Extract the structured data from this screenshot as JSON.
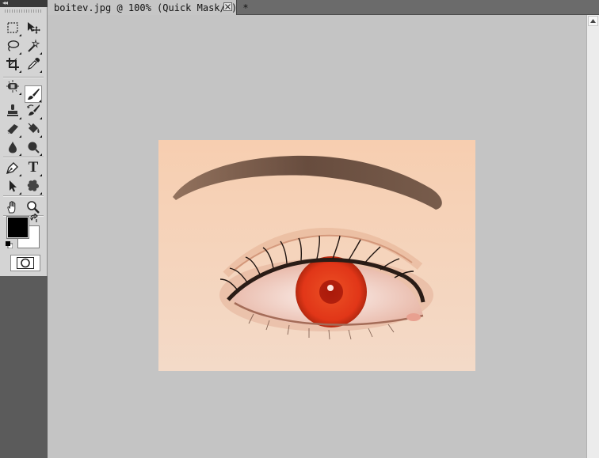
{
  "document": {
    "tab_title": "boitev.jpg @ 100% (Quick Mask/8) *"
  },
  "toolbox": {
    "collapse_glyph": "◂◂",
    "foreground_color": "#000000",
    "background_color": "#ffffff",
    "tools": [
      {
        "name": "rectangular-marquee-tool",
        "icon": "marquee-icon"
      },
      {
        "name": "move-tool",
        "icon": "move-icon"
      },
      {
        "name": "lasso-tool",
        "icon": "lasso-icon"
      },
      {
        "name": "magic-wand-tool",
        "icon": "magic-wand-icon"
      },
      {
        "name": "crop-tool",
        "icon": "crop-icon"
      },
      {
        "name": "eyedropper-tool",
        "icon": "eyedropper-icon"
      },
      {
        "name": "spot-healing-tool",
        "icon": "bandage-icon"
      },
      {
        "name": "brush-tool",
        "icon": "brush-icon",
        "active": true
      },
      {
        "name": "clone-stamp-tool",
        "icon": "stamp-icon"
      },
      {
        "name": "history-brush-tool",
        "icon": "history-brush-icon"
      },
      {
        "name": "eraser-tool",
        "icon": "eraser-icon"
      },
      {
        "name": "paint-bucket-tool",
        "icon": "bucket-icon"
      },
      {
        "name": "blur-tool",
        "icon": "drop-icon"
      },
      {
        "name": "dodge-tool",
        "icon": "dodge-icon"
      },
      {
        "name": "pen-tool",
        "icon": "pen-icon"
      },
      {
        "name": "type-tool",
        "icon": "type-icon",
        "label": "T"
      },
      {
        "name": "path-selection-tool",
        "icon": "arrow-icon"
      },
      {
        "name": "custom-shape-tool",
        "icon": "shape-icon"
      },
      {
        "name": "hand-tool",
        "icon": "hand-icon"
      },
      {
        "name": "zoom-tool",
        "icon": "zoom-icon"
      }
    ]
  },
  "image": {
    "iris_color": "#e23a1c",
    "skin_color": "#f5d3b8"
  }
}
